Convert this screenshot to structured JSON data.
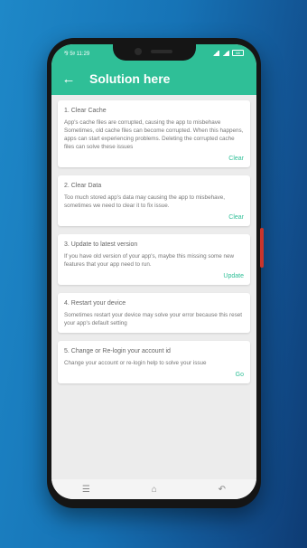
{
  "status_bar": {
    "left_text": "⅋ 5ᵍ 11:29",
    "battery_text": "68"
  },
  "app_bar": {
    "title": "Solution here",
    "back_icon": "arrow-left-icon"
  },
  "cards": [
    {
      "title": "1. Clear Cache",
      "description": "App's cache files are corrupted, causing the app to misbehave\n Sometimes, old cache files can become corrupted. When this happens, apps can start experiencing problems. Deleting the corrupted cache files can solve these issues",
      "action": "Clear"
    },
    {
      "title": "2. Clear Data",
      "description": "Too much stored app's data may causing the app to misbehave, sometimes we need to clear it to fix issue.",
      "action": "Clear"
    },
    {
      "title": "3. Update to latest version",
      "description": "If you have old version of your app's, maybe this missing some new features that your app need to run.",
      "action": "Update"
    },
    {
      "title": "4. Restart your device",
      "description": "Sometimes restart your device may solve your error because this reset your app's default setting",
      "action": ""
    },
    {
      "title": "5. Change or Re-login your account id",
      "description": "Change your account or re-login help to solve your issue",
      "action": "Go"
    }
  ],
  "nav_bar": {
    "recents": "☰",
    "home": "⌂",
    "back": "↶"
  },
  "colors": {
    "accent": "#2fbf97",
    "background_start": "#1e88c8",
    "background_end": "#0e3b73"
  }
}
